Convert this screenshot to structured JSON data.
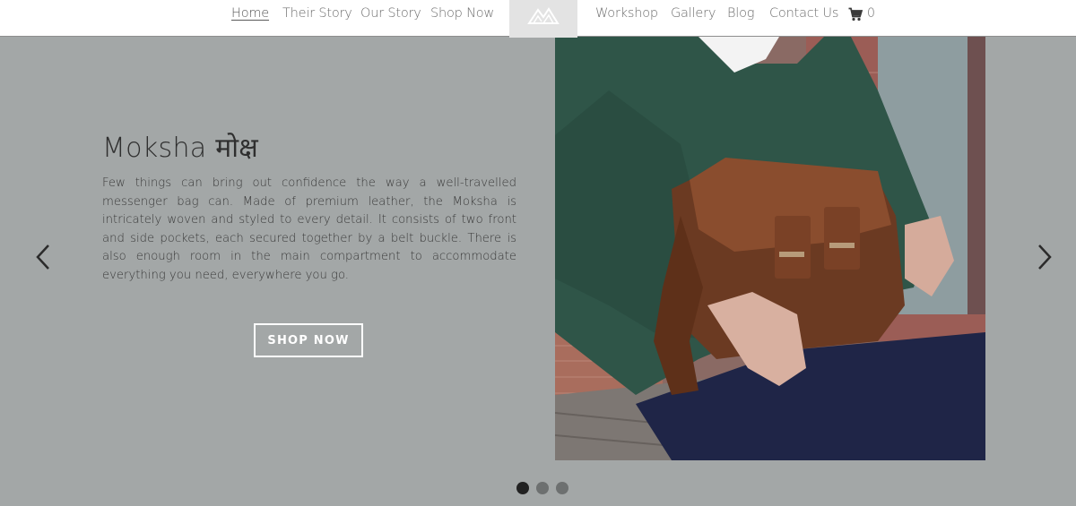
{
  "nav": {
    "left": [
      {
        "label": "Home",
        "active": true
      },
      {
        "label": "Their Story"
      },
      {
        "label": "Our Story"
      },
      {
        "label": "Shop Now"
      }
    ],
    "right": [
      {
        "label": "Workshop"
      },
      {
        "label": "Gallery"
      },
      {
        "label": "Blog"
      },
      {
        "label": "Contact Us"
      }
    ],
    "cart_count": "0",
    "logo_icon": "mountain-logo-icon",
    "cart_icon": "shopping-cart-icon"
  },
  "hero": {
    "title": "Moksha मोक्ष",
    "description": "Few things can bring out confidence the way a well-travelled messenger bag can. Made of premium leather, the Moksha is intricately woven and styled to every detail. It consists of two front and side pockets, each secured together by a belt buckle. There is also enough room in the main compartment to accommodate everything you need, everywhere you go.",
    "button_label": "SHOP NOW",
    "prev_icon": "chevron-left-icon",
    "next_icon": "chevron-right-icon"
  },
  "carousel": {
    "slide_count": 3,
    "active_index": 0
  },
  "colors": {
    "hero_bg": "#a3a7a7",
    "sweater": "#2f5548",
    "bag_leather": "#6b3a22",
    "jeans": "#1f2547"
  }
}
